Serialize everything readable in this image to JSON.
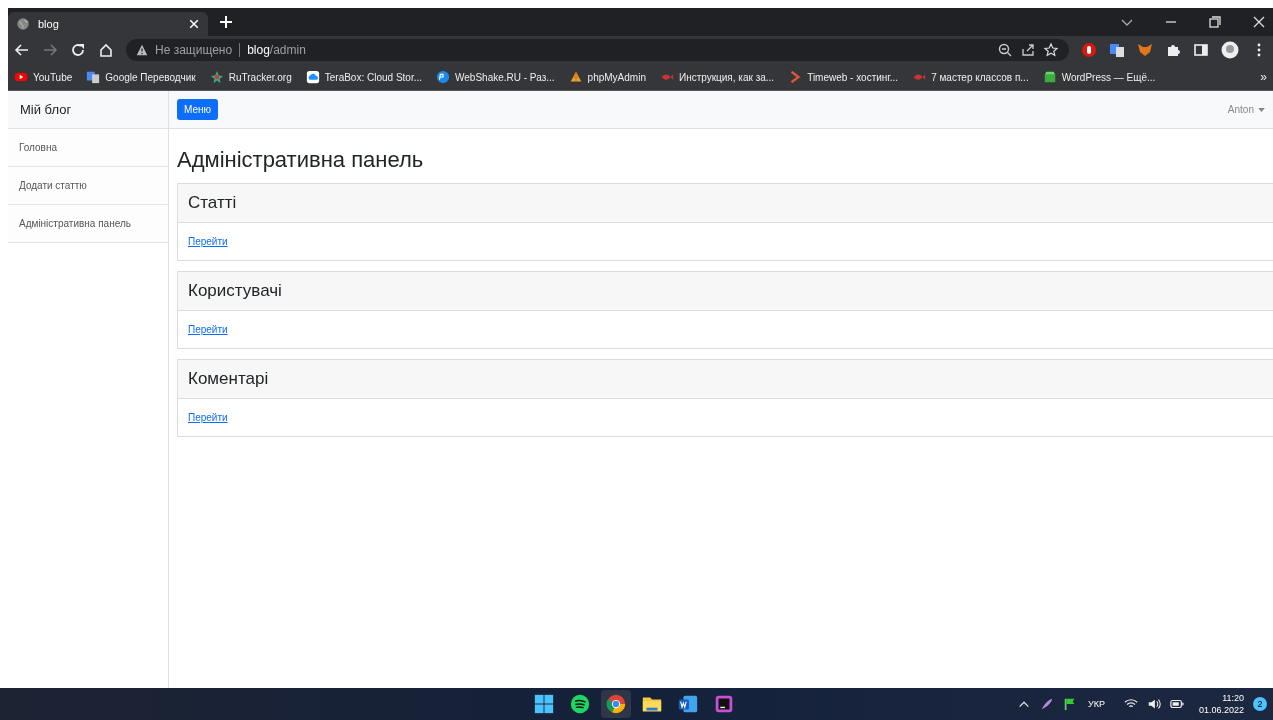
{
  "browser": {
    "tab": {
      "title": "blog",
      "selected": true
    },
    "address": {
      "warning": "Не защищено",
      "host": "blog",
      "path": "/admin"
    },
    "bookmarks": [
      {
        "label": "YouTube",
        "kind": "video"
      },
      {
        "label": "Google Переводчик",
        "kind": "translate"
      },
      {
        "label": "RuTracker.org",
        "kind": "star"
      },
      {
        "label": "TeraBox: Cloud Stor...",
        "kind": "cloud"
      },
      {
        "label": "WebShake.RU - Раз...",
        "kind": "php"
      },
      {
        "label": "phpMyAdmin",
        "kind": "sail"
      },
      {
        "label": "Инструкция, как за...",
        "kind": "fish"
      },
      {
        "label": "Timeweb - хостинг...",
        "kind": "chevron"
      },
      {
        "label": "7 мастер классов п...",
        "kind": "fish"
      },
      {
        "label": "WordPress — Ещё...",
        "kind": "box"
      }
    ],
    "bookmarks_overflow": "»"
  },
  "sidebar": {
    "brand": "Мій блог",
    "items": [
      {
        "label": "Головна"
      },
      {
        "label": "Додати статтю"
      },
      {
        "label": "Адміністративна панель"
      }
    ]
  },
  "topbar": {
    "menu_button": "Меню",
    "user": "Anton"
  },
  "page": {
    "heading": "Адміністративна панель",
    "cards": [
      {
        "title": "Статті",
        "link": "Перейти"
      },
      {
        "title": "Користувачі",
        "link": "Перейти"
      },
      {
        "title": "Коментарі",
        "link": "Перейти"
      }
    ]
  },
  "taskbar": {
    "apps": [
      {
        "kind": "start",
        "active": false
      },
      {
        "kind": "music",
        "active": false
      },
      {
        "kind": "browser",
        "active": true
      },
      {
        "kind": "folder",
        "active": false
      },
      {
        "kind": "word",
        "active": false
      },
      {
        "kind": "ide",
        "active": false
      }
    ],
    "language": "УКР",
    "time": "11:20",
    "date": "01.06.2022",
    "notifications": "2"
  }
}
